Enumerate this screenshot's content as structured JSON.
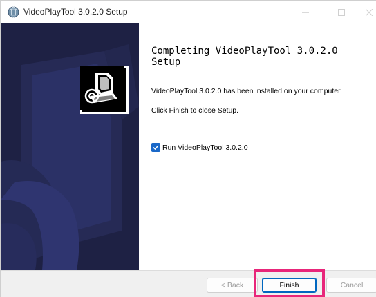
{
  "window": {
    "title": "VideoPlayTool 3.0.2.0 Setup",
    "icons": {
      "app": "installer-globe-icon",
      "minimize": "minimize-icon",
      "maximize": "maximize-icon",
      "close": "close-icon"
    }
  },
  "sidebar": {
    "logo_icon": "computer-installer-icon",
    "colors": {
      "background": "#1e2144",
      "pattern": "#2b3166"
    }
  },
  "content": {
    "heading": "Completing VideoPlayTool 3.0.2.0 Setup",
    "line1": "VideoPlayTool 3.0.2.0 has been installed on your computer.",
    "line2": "Click Finish to close Setup.",
    "run_checkbox": {
      "label": "Run VideoPlayTool 3.0.2.0",
      "checked": true
    }
  },
  "buttons": {
    "back": "< Back",
    "finish": "Finish",
    "cancel": "Cancel"
  },
  "colors": {
    "accent": "#1a68c8",
    "highlight": "#e8267a"
  }
}
